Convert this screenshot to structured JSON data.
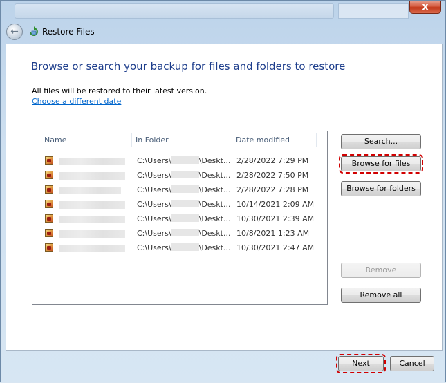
{
  "window": {
    "title": "Restore Files",
    "close_glyph": "x"
  },
  "icons": {
    "back": "back-arrow-icon",
    "app": "restore-files-icon",
    "file": "image-file-icon",
    "close": "close-icon"
  },
  "colors": {
    "heading": "#1e3e8c",
    "link": "#0066cc",
    "highlight": "#d10000"
  },
  "main": {
    "heading": "Browse or search your backup for files and folders to restore",
    "note": "All files will be restored to their latest version.",
    "choose_date_link": "Choose a different date"
  },
  "list": {
    "columns": [
      "Name",
      "In Folder",
      "Date modified"
    ],
    "rows": [
      {
        "folder_prefix": "C:\\Users\\",
        "folder_suffix": "\\Deskt...",
        "date": "2/28/2022 7:29 PM"
      },
      {
        "folder_prefix": "C:\\Users\\",
        "folder_suffix": "\\Deskt...",
        "date": "2/28/2022 7:50 PM"
      },
      {
        "folder_prefix": "C:\\Users\\",
        "folder_suffix": "\\Deskt...",
        "date": "2/28/2022 7:28 PM"
      },
      {
        "folder_prefix": "C:\\Users\\",
        "folder_suffix": "\\Deskt...",
        "date": "10/14/2021 2:09 AM"
      },
      {
        "folder_prefix": "C:\\Users\\",
        "folder_suffix": "\\Deskt...",
        "date": "10/30/2021 2:39 AM"
      },
      {
        "folder_prefix": "C:\\Users\\",
        "folder_suffix": "\\Deskt...",
        "date": "10/8/2021 1:23 AM"
      },
      {
        "folder_prefix": "C:\\Users\\",
        "folder_suffix": "\\Deskt...",
        "date": "10/30/2021 2:47 AM"
      }
    ]
  },
  "buttons": {
    "search": "Search...",
    "browse_files": "Browse for files",
    "browse_folders": "Browse for folders",
    "remove": "Remove",
    "remove_all": "Remove all",
    "next": "Next",
    "cancel": "Cancel"
  }
}
